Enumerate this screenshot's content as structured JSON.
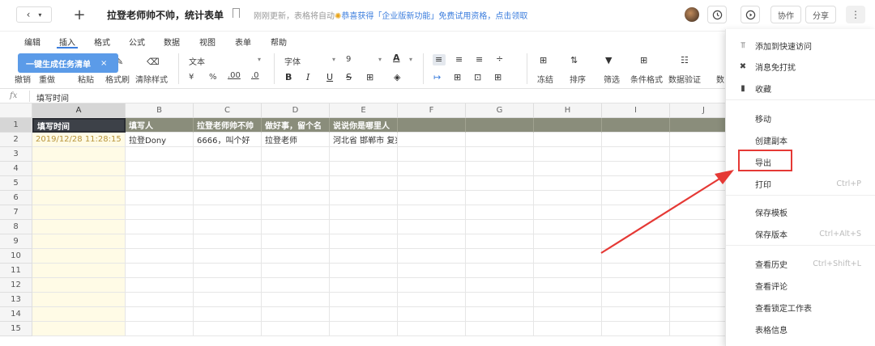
{
  "topbar": {
    "title": "拉登老师帅不帅，统计表单",
    "status": "刚刚更新，表格将自动",
    "promo": "恭喜获得「企业版新功能」免费试用资格，点击领取",
    "collab": "协作",
    "share": "分享"
  },
  "menubar": {
    "items": [
      "编辑",
      "插入",
      "格式",
      "公式",
      "数据",
      "视图",
      "表单",
      "帮助"
    ]
  },
  "toolbar": {
    "tooltip": "一键生成任务清单",
    "undo": "撤销",
    "redo": "重做",
    "paste": "粘贴",
    "format_painter": "格式刷",
    "clear_format": "清除样式",
    "text_type": "文本",
    "currency": "¥",
    "percent": "%",
    "dec_inc": ".00",
    "dec_dec": ".0",
    "font": "字体",
    "font_size": "9",
    "bold": "B",
    "italic": "I",
    "underline": "U",
    "strike": "S",
    "freeze": "冻结",
    "sort": "排序",
    "filter": "筛选",
    "cond_format": "条件格式",
    "validation": "数据验证",
    "more": "数"
  },
  "formula": {
    "fx": "fx",
    "value": "填写时间"
  },
  "grid": {
    "columns": [
      "A",
      "B",
      "C",
      "D",
      "E",
      "F",
      "G",
      "H",
      "I",
      "J"
    ],
    "rows": [
      "1",
      "2",
      "3",
      "4",
      "5",
      "6",
      "7",
      "8",
      "9",
      "10",
      "11",
      "12",
      "13",
      "14",
      "15"
    ],
    "header_row": [
      "填写时间",
      "填写人",
      "拉登老师帅不帅",
      "做好事，留个名",
      "说说你是哪里人"
    ],
    "data_row": [
      "2019/12/28 11:28:15",
      "拉登Dony",
      "6666，叫个好",
      "拉登老师",
      "河北省 邯郸市 复兴区 找不到"
    ]
  },
  "dropdown": {
    "items": [
      {
        "icon": "pin-icon",
        "label": "添加到快速访问",
        "shortcut": ""
      },
      {
        "icon": "mute-icon",
        "label": "消息免打扰",
        "shortcut": ""
      },
      {
        "icon": "bookmark-icon",
        "label": "收藏",
        "shortcut": ""
      },
      {
        "icon": "",
        "label": "移动",
        "shortcut": ""
      },
      {
        "icon": "",
        "label": "创建副本",
        "shortcut": ""
      },
      {
        "icon": "",
        "label": "导出",
        "shortcut": ""
      },
      {
        "icon": "",
        "label": "打印",
        "shortcut": "Ctrl+P"
      },
      {
        "icon": "",
        "label": "保存模板",
        "shortcut": ""
      },
      {
        "icon": "",
        "label": "保存版本",
        "shortcut": "Ctrl+Alt+S"
      },
      {
        "icon": "",
        "label": "查看历史",
        "shortcut": "Ctrl+Shift+L"
      },
      {
        "icon": "",
        "label": "查看评论",
        "shortcut": ""
      },
      {
        "icon": "",
        "label": "查看锁定工作表",
        "shortcut": ""
      },
      {
        "icon": "",
        "label": "表格信息",
        "shortcut": ""
      }
    ]
  },
  "colors": {
    "accent": "#3b7ddd",
    "header_fill": "#8a8d7b",
    "selected_header": "#3d4148",
    "highlight_box": "#e53935"
  }
}
